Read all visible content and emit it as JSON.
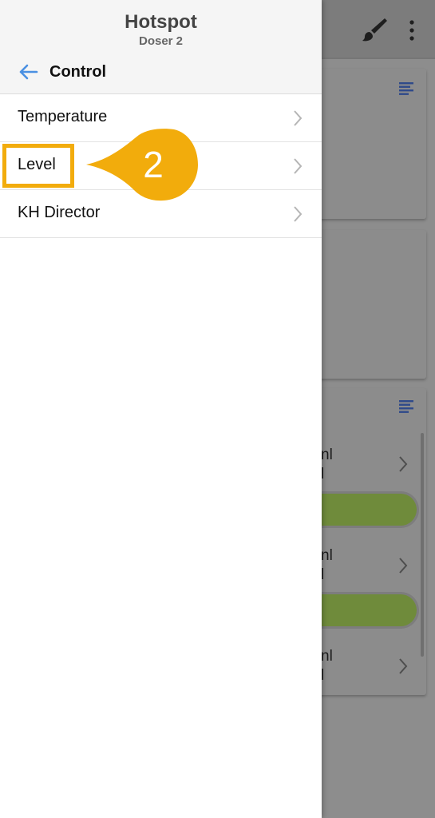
{
  "drawer": {
    "title": "Hotspot",
    "subtitle": "Doser 2",
    "back_label": "Control",
    "items": [
      {
        "label": "Temperature"
      },
      {
        "label": "Level"
      },
      {
        "label": "KH Director"
      }
    ]
  },
  "annotation": {
    "step_number": "2",
    "highlighted_item": "Level"
  },
  "background": {
    "visible_fragments": [
      "nl",
      "l",
      "nl",
      "l",
      "nl",
      "l"
    ]
  },
  "colors": {
    "callout": "#f2ac0c",
    "accent_blue": "#4a90e2",
    "progress_green": "#6f8b3b",
    "drawer_header_bg": "#f5f5f5"
  },
  "icons": {
    "back": "arrow-left-icon",
    "chevron": "chevron-right-icon",
    "brush": "brush-icon",
    "more": "more-vertical-icon",
    "list": "list-icon"
  }
}
